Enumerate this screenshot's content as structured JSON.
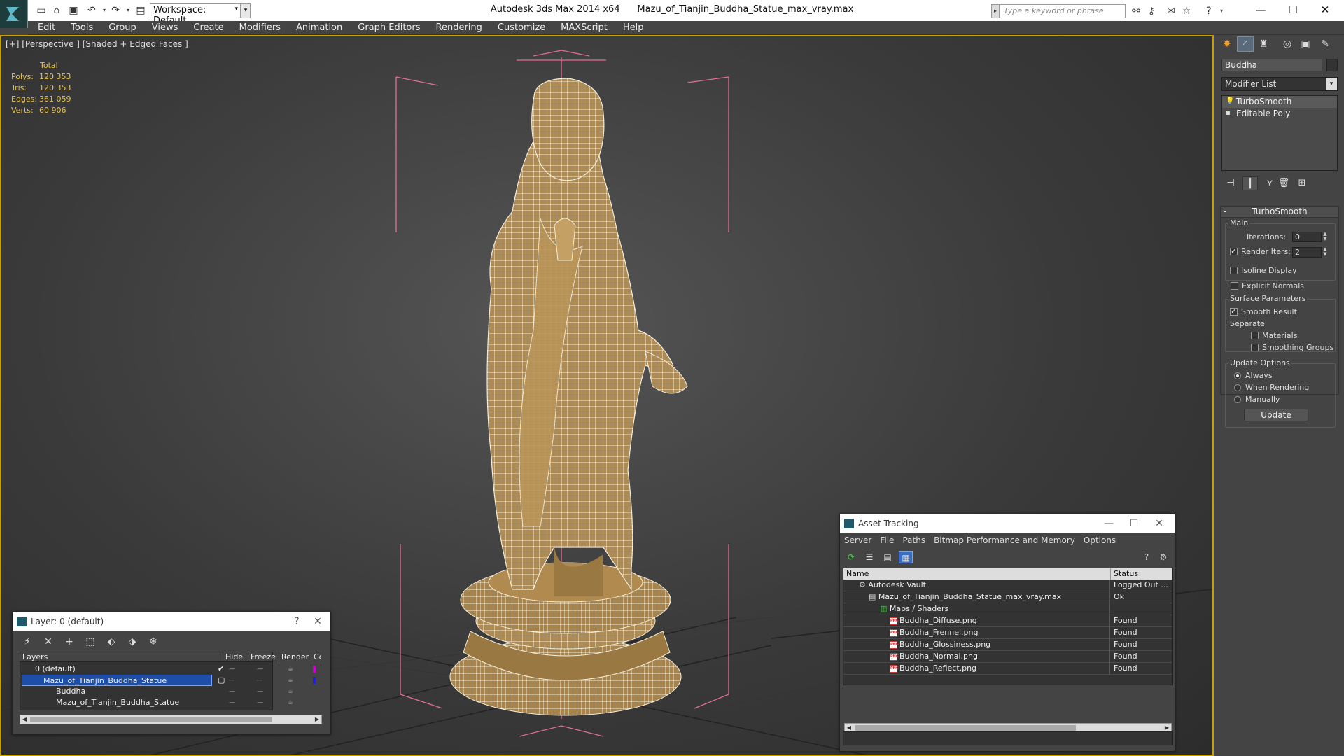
{
  "title": {
    "app": "Autodesk 3ds Max  2014 x64",
    "file": "Mazu_of_Tianjin_Buddha_Statue_max_vray.max",
    "workspace": "Workspace: Default",
    "search_placeholder": "Type a keyword or phrase"
  },
  "menu": [
    "Edit",
    "Tools",
    "Group",
    "Views",
    "Create",
    "Modifiers",
    "Animation",
    "Graph Editors",
    "Rendering",
    "Customize",
    "MAXScript",
    "Help"
  ],
  "viewport": {
    "label": "[+] [Perspective ] [Shaded + Edged Faces ]",
    "stats_header": "Total",
    "stats": [
      {
        "k": "Polys:",
        "v": "120 353"
      },
      {
        "k": "Tris:",
        "v": "120 353"
      },
      {
        "k": "Edges:",
        "v": "361 059"
      },
      {
        "k": "Verts:",
        "v": "60 906"
      }
    ]
  },
  "command_panel": {
    "object_name": "Buddha",
    "modifier_list": "Modifier List",
    "stack": [
      "TurboSmooth",
      "Editable Poly"
    ],
    "rollout_title": "TurboSmooth",
    "main_group": "Main",
    "iterations_label": "Iterations:",
    "iterations_value": "0",
    "render_iters_label": "Render Iters:",
    "render_iters_value": "2",
    "isoline_label": "Isoline Display",
    "explicit_label": "Explicit Normals",
    "surface_group": "Surface Parameters",
    "smooth_result": "Smooth Result",
    "separate_label": "Separate",
    "materials_label": "Materials",
    "smoothing_groups_label": "Smoothing Groups",
    "update_group": "Update Options",
    "always": "Always",
    "when_rendering": "When Rendering",
    "manually": "Manually",
    "update_btn": "Update"
  },
  "layer_dialog": {
    "title": "Layer: 0 (default)",
    "help": "?",
    "columns": {
      "layers": "Layers",
      "hide": "Hide",
      "freeze": "Freeze",
      "render": "Render",
      "color": "Cc"
    },
    "rows": [
      {
        "name": "0 (default)"
      },
      {
        "name": "Mazu_of_Tianjin_Buddha_Statue"
      },
      {
        "name": "Buddha"
      },
      {
        "name": "Mazu_of_Tianjin_Buddha_Statue"
      }
    ]
  },
  "asset_tracking": {
    "title": "Asset Tracking",
    "menu": [
      "Server",
      "File",
      "Paths",
      "Bitmap Performance and Memory",
      "Options"
    ],
    "col_name": "Name",
    "col_status": "Status",
    "rows": [
      {
        "name": "Autodesk Vault",
        "status": "Logged Out ..."
      },
      {
        "name": "Mazu_of_Tianjin_Buddha_Statue_max_vray.max",
        "status": "Ok"
      },
      {
        "name": "Maps / Shaders",
        "status": ""
      },
      {
        "name": "Buddha_Diffuse.png",
        "status": "Found"
      },
      {
        "name": "Buddha_Frennel.png",
        "status": "Found"
      },
      {
        "name": "Buddha_Glossiness.png",
        "status": "Found"
      },
      {
        "name": "Buddha_Normal.png",
        "status": "Found"
      },
      {
        "name": "Buddha_Reflect.png",
        "status": "Found"
      }
    ],
    "png_tag": "PNG"
  },
  "colors": {
    "accent": "#c8a000",
    "selection": "#1e4fa8",
    "stats": "#e6c14d",
    "wire": "#ffffff",
    "mesh": "#b28c50"
  }
}
